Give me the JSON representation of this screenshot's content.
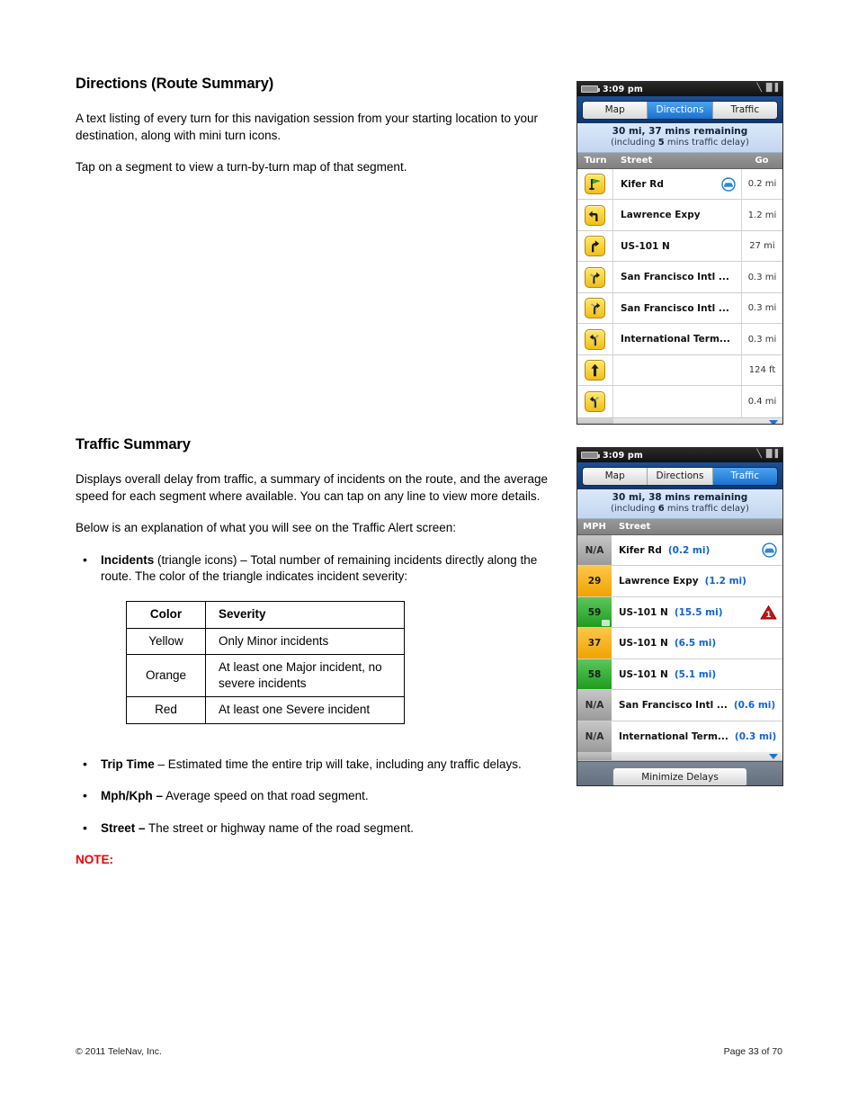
{
  "document": {
    "sections": [
      {
        "id": "directions",
        "title": "Directions (Route Summary)",
        "paragraphs": [
          "A text listing of every turn for this navigation session from your starting location to your destination, along with mini turn icons.",
          "Tap on a segment to view a turn-by-turn map of that segment."
        ]
      },
      {
        "id": "traffic",
        "title": "Traffic Summary",
        "paragraphs": [
          "Displays overall delay from traffic, a summary of incidents on the route, and the average speed for each segment where available. You can tap on any line to view more details.",
          "Below is an explanation of what you will see on the Traffic Alert screen:"
        ]
      }
    ],
    "bullets_top": [
      {
        "lead": "Incidents",
        "rest": " (triangle icons) – Total number of remaining incidents directly along the route. The color of the triangle indicates incident severity:"
      }
    ],
    "severity_table": {
      "headers": [
        "Color",
        "Severity"
      ],
      "rows": [
        [
          "Yellow",
          "Only Minor incidents"
        ],
        [
          "Orange",
          "At least one Major incident, no severe incidents"
        ],
        [
          "Red",
          "At least one Severe incident"
        ]
      ]
    },
    "bullets_bottom": [
      {
        "lead": "Trip Time",
        "rest": " – Estimated time the entire trip will take, including any traffic delays."
      },
      {
        "lead": "Mph/Kph –",
        "rest": " Average speed on that road segment."
      },
      {
        "lead": "Street –",
        "rest": " The street or highway name of the road segment."
      }
    ],
    "note_label": "NOTE:",
    "note_color": "#ee0000",
    "footer": {
      "copyright": "© 2011 TeleNav, Inc.",
      "page": "Page 33 of 70"
    }
  },
  "phone_directions": {
    "status": {
      "time": "3:09 pm",
      "battery_icon": "battery-icon",
      "signal_icon": "signal-icon",
      "network_icon": "network-icon"
    },
    "tabs": [
      {
        "label": "Map",
        "active": false
      },
      {
        "label": "Directions",
        "active": true
      },
      {
        "label": "Traffic",
        "active": false
      }
    ],
    "summary": {
      "line1": "30 mi, 37 mins remaining",
      "line2_pre": "(including ",
      "line2_bold": "5",
      "line2_post": " mins traffic delay)"
    },
    "columns": {
      "turn": "Turn",
      "street": "Street",
      "go": "Go"
    },
    "rows": [
      {
        "icon": "flag-start-icon",
        "street": "Kifer Rd",
        "go": "0.2 mi",
        "car_badge": true
      },
      {
        "icon": "turn-left-icon",
        "street": "Lawrence Expy",
        "go": "1.2 mi",
        "car_badge": false
      },
      {
        "icon": "turn-right-icon",
        "street": "US-101 N",
        "go": "27 mi",
        "car_badge": false
      },
      {
        "icon": "bear-right-icon",
        "street": "San Francisco Intl ...",
        "go": "0.3 mi",
        "car_badge": false
      },
      {
        "icon": "fork-right-icon",
        "street": "San Francisco Intl ...",
        "go": "0.3 mi",
        "car_badge": false
      },
      {
        "icon": "fork-left-icon",
        "street": "International Term...",
        "go": "0.3 mi",
        "car_badge": false
      },
      {
        "icon": "straight-icon",
        "street": "",
        "go": "124 ft",
        "car_badge": false
      },
      {
        "icon": "fork-left-icon",
        "street": "",
        "go": "0.4 mi",
        "car_badge": false
      }
    ]
  },
  "phone_traffic": {
    "status": {
      "time": "3:09 pm",
      "battery_icon": "battery-icon",
      "signal_icon": "signal-icon",
      "network_icon": "network-icon"
    },
    "tabs": [
      {
        "label": "Map",
        "active": false
      },
      {
        "label": "Directions",
        "active": false
      },
      {
        "label": "Traffic",
        "active": true
      }
    ],
    "summary": {
      "line1": "30 mi, 38 mins remaining",
      "line2_pre": "(including ",
      "line2_bold": "6",
      "line2_post": " mins traffic delay)"
    },
    "columns": {
      "mph": "MPH",
      "street": "Street"
    },
    "rows": [
      {
        "mph": "N/A",
        "speed_color": "gray",
        "street": "Kifer Rd",
        "distance": "(0.2 mi)",
        "car_badge": true,
        "incident": null,
        "handle": false
      },
      {
        "mph": "29",
        "speed_color": "orange",
        "street": "Lawrence Expy",
        "distance": "(1.2 mi)",
        "car_badge": false,
        "incident": null,
        "handle": false
      },
      {
        "mph": "59",
        "speed_color": "green",
        "street": "US-101 N",
        "distance": "(15.5 mi)",
        "car_badge": false,
        "incident": "1",
        "handle": true
      },
      {
        "mph": "37",
        "speed_color": "orange",
        "street": "US-101 N",
        "distance": "(6.5 mi)",
        "car_badge": false,
        "incident": null,
        "handle": false
      },
      {
        "mph": "58",
        "speed_color": "green",
        "street": "US-101 N",
        "distance": "(5.1 mi)",
        "car_badge": false,
        "incident": null,
        "handle": false
      },
      {
        "mph": "N/A",
        "speed_color": "gray",
        "street": "San Francisco Intl ...",
        "distance": "(0.6 mi)",
        "car_badge": false,
        "incident": null,
        "handle": false
      },
      {
        "mph": "N/A",
        "speed_color": "gray",
        "street": "International Term...",
        "distance": "(0.3 mi)",
        "car_badge": false,
        "incident": null,
        "handle": false
      }
    ],
    "minimize_button": "Minimize Delays",
    "colors": {
      "speed_green": "#1d9d1d",
      "speed_orange": "#f0a400",
      "speed_gray": "#9a9a9a",
      "distance_blue": "#1163d6",
      "incident_red": "#cc1111"
    }
  }
}
